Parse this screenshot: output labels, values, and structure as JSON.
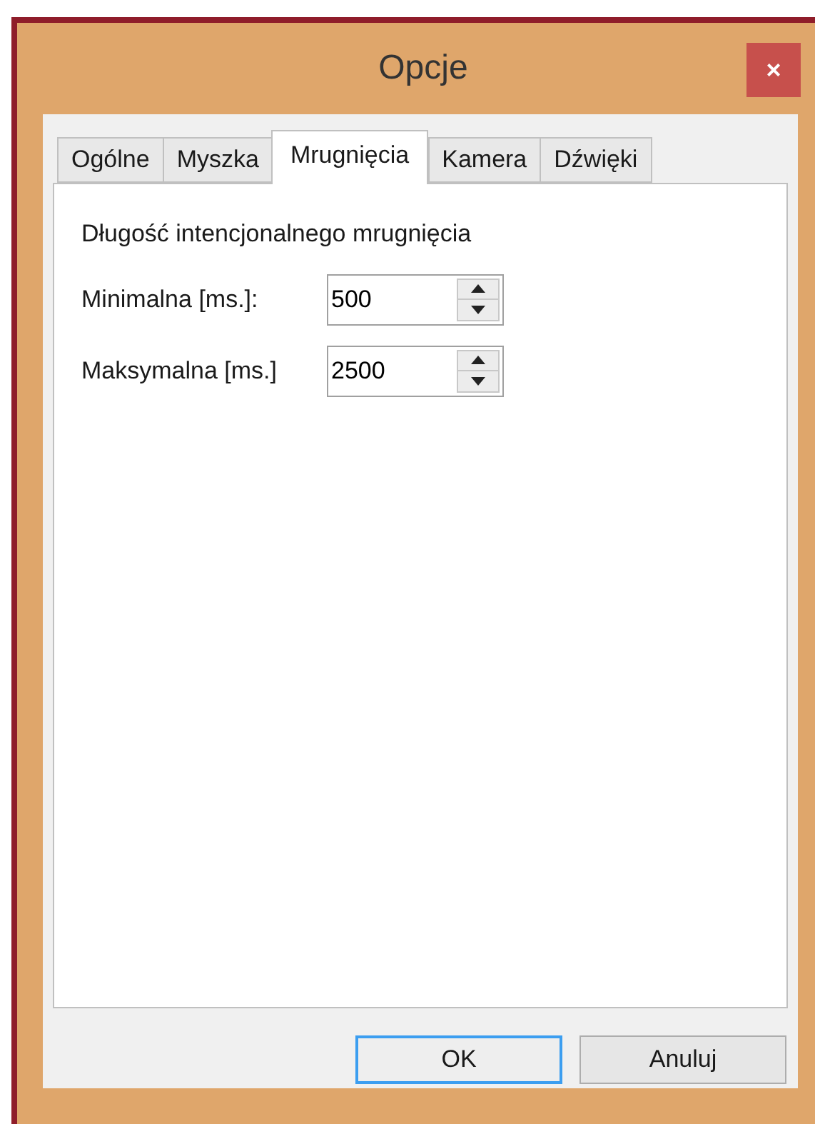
{
  "window": {
    "title": "Opcje",
    "close": "×"
  },
  "tabs": [
    {
      "label": "Ogólne",
      "selected": false
    },
    {
      "label": "Myszka",
      "selected": false
    },
    {
      "label": "Mrugnięcia",
      "selected": true
    },
    {
      "label": "Kamera",
      "selected": false
    },
    {
      "label": "Dźwięki",
      "selected": false
    }
  ],
  "section_label": "Długość intencjonalnego mrugnięcia",
  "fields": [
    {
      "label": "Minimalna [ms.]:",
      "value": "500"
    },
    {
      "label": "Maksymalna [ms.]",
      "value": "2500"
    }
  ],
  "buttons": [
    {
      "label": "OK",
      "default": true
    },
    {
      "label": "Anuluj",
      "default": false
    }
  ]
}
